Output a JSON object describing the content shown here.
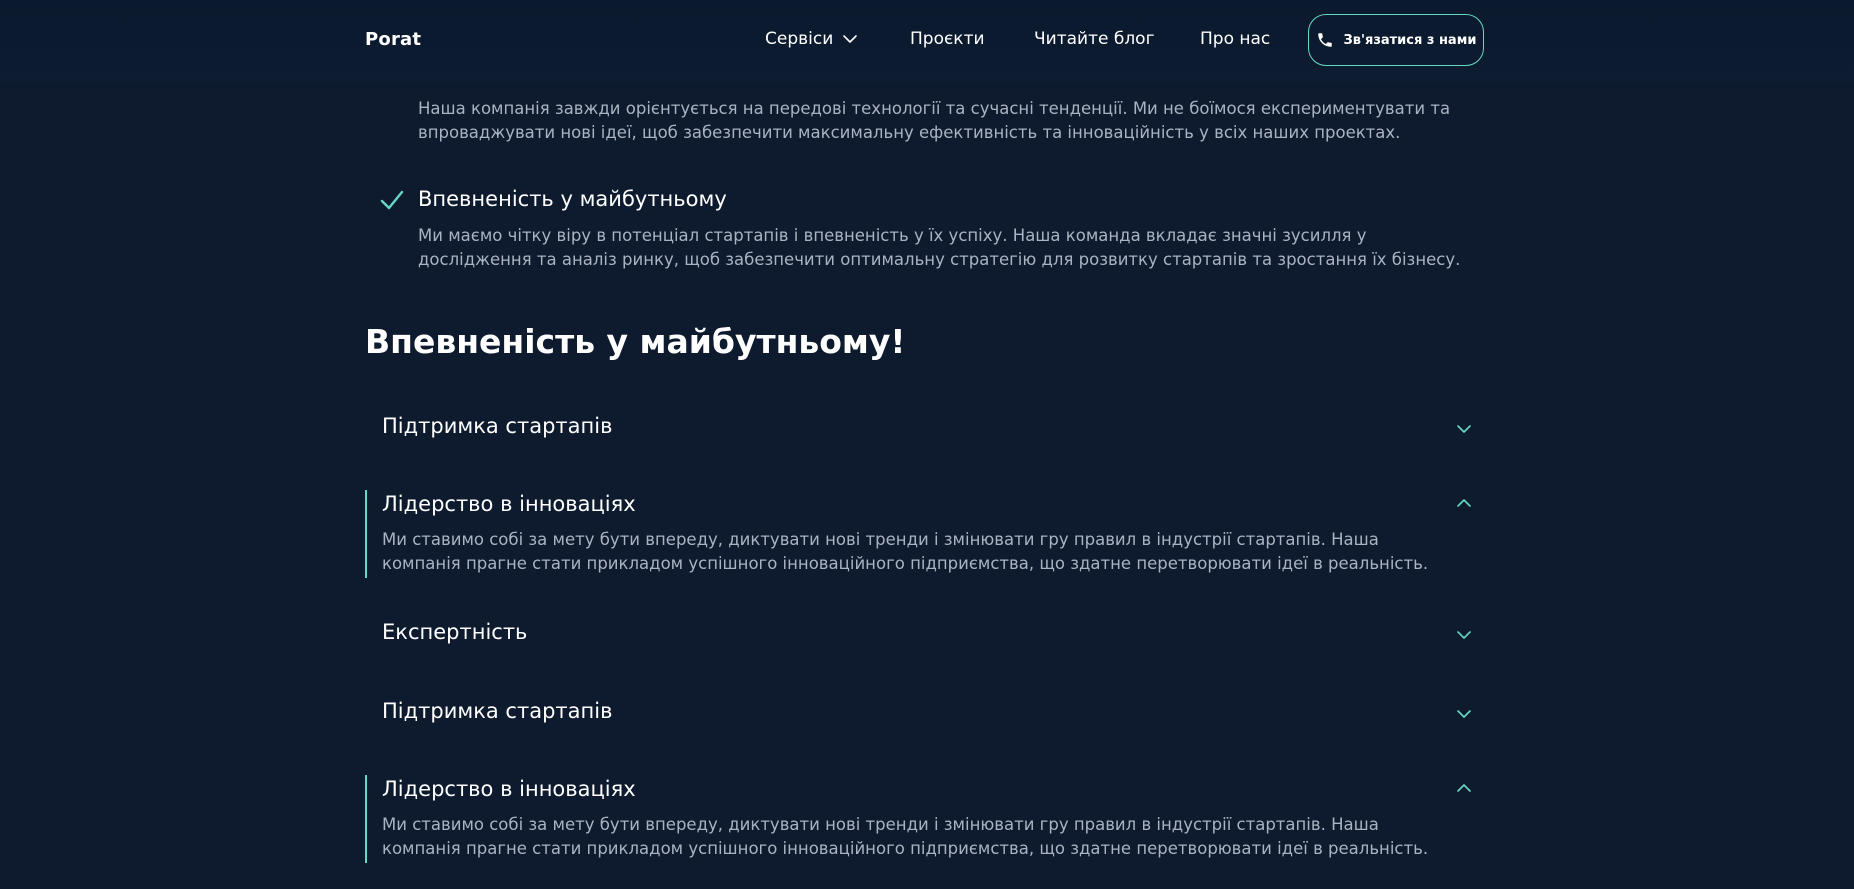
{
  "header": {
    "logo": "Porat",
    "nav": {
      "services": "Сервіси",
      "projects": "Проєкти",
      "blog": "Читайте блог",
      "about": "Про нас"
    },
    "contact_button": "Зв'язатися з нами"
  },
  "features": [
    {
      "title": "",
      "text": "Наша компанія завжди орієнтується на передові технології та сучасні тенденції. Ми не боїмося експериментувати та впроваджувати нові ідеї, щоб забезпечити максимальну ефективність та інноваційність у всіх наших проектах."
    },
    {
      "title": "Впевненість у майбутньому",
      "text": "Ми маємо чітку віру в потенціал стартапів і впевненість у їх успіху. Наша команда вкладає значні зусилля у дослідження та аналіз ринку, щоб забезпечити оптимальну стратегію для розвитку стартапів та зростання їх бізнесу."
    }
  ],
  "section": {
    "title": "Впевненість у майбутньому!"
  },
  "accordion": [
    {
      "title": "Підтримка стартапів",
      "expanded": false,
      "body": ""
    },
    {
      "title": "Лідерство в інноваціях",
      "expanded": true,
      "body": "Ми ставимо собі за мету бути впереду, диктувати нові тренди і змінювати гру правил в індустрії стартапів. Наша компанія прагне стати прикладом успішного інноваційного підприємства, що здатне перетворювати ідеї в реальність."
    },
    {
      "title": "Експертність",
      "expanded": false,
      "body": ""
    },
    {
      "title": "Підтримка стартапів",
      "expanded": false,
      "body": ""
    },
    {
      "title": "Лідерство в інноваціях",
      "expanded": true,
      "body": "Ми ставимо собі за мету бути впереду, диктувати нові тренди і змінювати гру правил в індустрії стартапів. Наша компанія прагне стати прикладом успішного інноваційного підприємства, що здатне перетворювати ідеї в реальність."
    }
  ],
  "colors": {
    "background": "#0e1b2e",
    "accent": "#66d9c4",
    "body_text": "#a9b3c1",
    "heading_text": "#ffffff"
  },
  "icons": {
    "nav_services": "chevron-down-icon",
    "contact": "phone-icon",
    "feature": "check-icon",
    "accordion_collapsed": "chevron-down-icon",
    "accordion_expanded": "chevron-up-icon"
  }
}
